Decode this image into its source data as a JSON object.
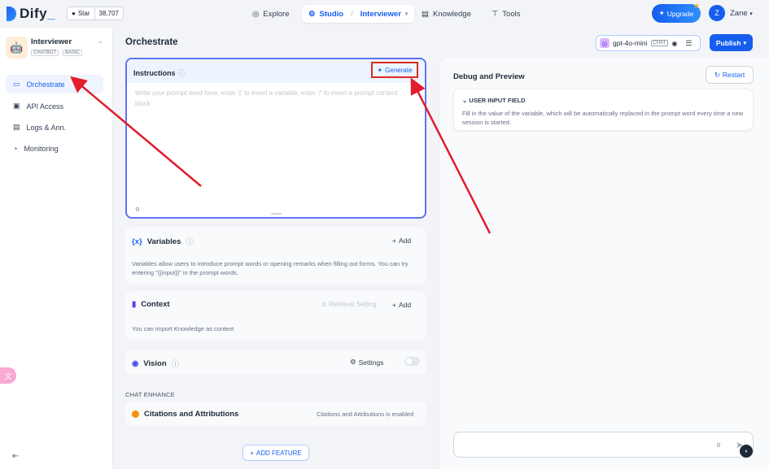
{
  "brand": {
    "name": "Dify",
    "accent": "#155eef"
  },
  "github": {
    "label": "Star",
    "count": "38,707"
  },
  "nav": {
    "explore": "Explore",
    "studio": "Studio",
    "studio_app": "Interviewer",
    "knowledge": "Knowledge",
    "tools": "Tools"
  },
  "header": {
    "upgrade": "Upgrade",
    "avatar_letter": "Z",
    "user": "Zane"
  },
  "app": {
    "name": "Interviewer",
    "tags": [
      "CHATBOT",
      "BASIC"
    ]
  },
  "sidebar": {
    "items": [
      {
        "label": "Orchestrate",
        "icon": "layout-icon"
      },
      {
        "label": "API Access",
        "icon": "terminal-icon"
      },
      {
        "label": "Logs & Ann.",
        "icon": "file-text-icon"
      },
      {
        "label": "Monitoring",
        "icon": "chart-icon"
      }
    ]
  },
  "main": {
    "title": "Orchestrate",
    "model": {
      "name": "gpt-4o-mini",
      "badge": "CHAT"
    },
    "publish": "Publish"
  },
  "instructions": {
    "title": "Instructions",
    "generate": "Generate",
    "placeholder": "Write your prompt word here, enter '{' to insert a variable, enter '/' to insert a prompt content block",
    "count": "0"
  },
  "variables": {
    "title": "Variables",
    "add": "Add",
    "description": "Variables allow users to introduce prompt words or opening remarks when filling out forms. You can try entering \"{{input}}\" in the prompt words."
  },
  "context": {
    "title": "Context",
    "retrieval": "Retrieval Setting",
    "add": "Add",
    "description": "You can import Knowledge as context"
  },
  "vision": {
    "title": "Vision",
    "settings": "Settings"
  },
  "chat_enhance": {
    "label": "CHAT ENHANCE",
    "citations_title": "Citations and Attributions",
    "citations_status": "Citations and Attributions is enabled"
  },
  "add_feature": "ADD FEATURE",
  "debug": {
    "title": "Debug and Preview",
    "restart": "Restart",
    "uif_title": "USER INPUT FIELD",
    "uif_desc": "Fill in the value of the variable, which will be automatically replaced in the prompt word every time a new session is started.",
    "chat_count": "0"
  }
}
